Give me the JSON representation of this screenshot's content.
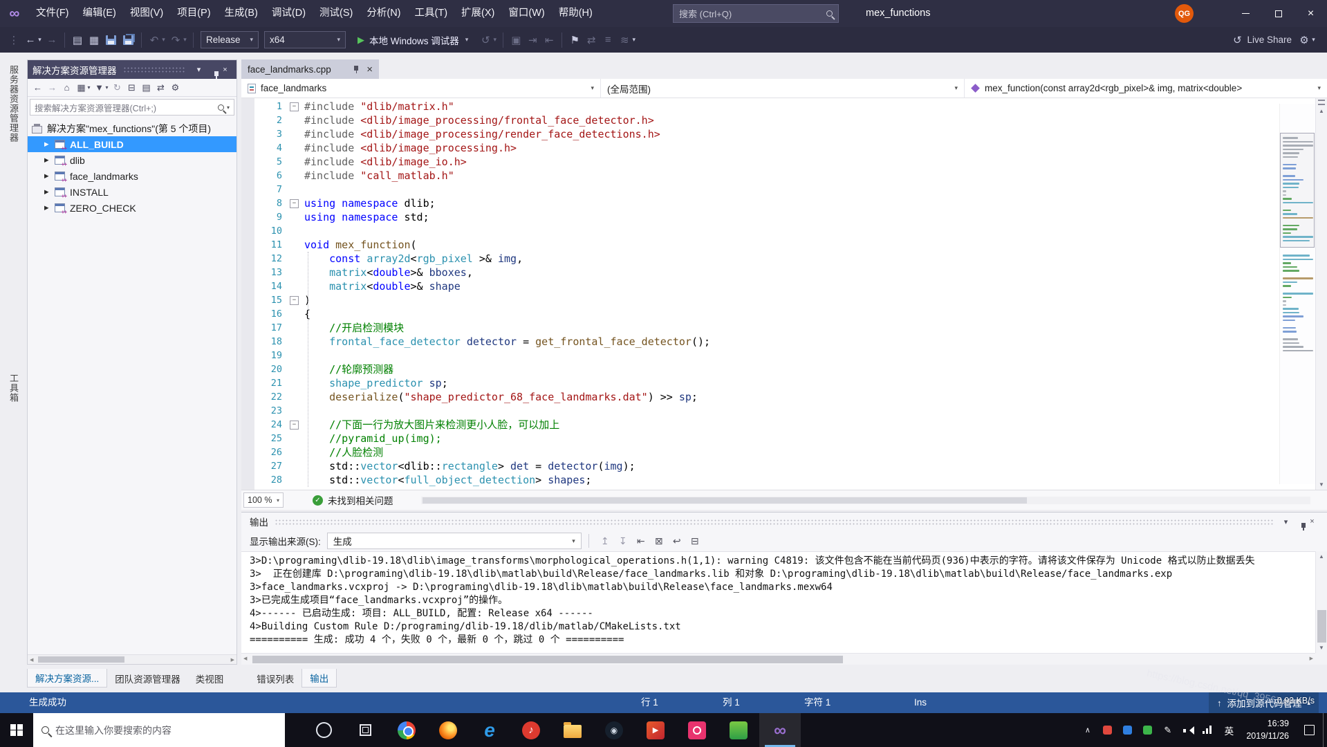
{
  "colors": {
    "selection": "#3399ff",
    "status_bar": "#2b579a",
    "title_bar": "#2f2f44",
    "taskbar": "#101018",
    "build_success_icon": "#3a9e3a",
    "tab_inactive": "#cccedb"
  },
  "icons": {
    "vs-logo": "∞",
    "close": "×",
    "dropdown": "▾",
    "tree-collapsed": "▶",
    "check": "✓",
    "up": "▲",
    "down": "▼",
    "left": "◀",
    "right": "▶",
    "play": "▶",
    "source-control-up": "↑",
    "caret-up": "▴"
  },
  "title_bar": {
    "menus": [
      "文件(F)",
      "编辑(E)",
      "视图(V)",
      "项目(P)",
      "生成(B)",
      "调试(D)",
      "测试(S)",
      "分析(N)",
      "工具(T)",
      "扩展(X)",
      "窗口(W)",
      "帮助(H)"
    ],
    "search_placeholder": "搜索 (Ctrl+Q)",
    "window_title": "mex_functions",
    "avatar_initials": "QG"
  },
  "toolbar": {
    "items": [
      {
        "t": "glyph",
        "name": "toolbar-grip-icon",
        "g": "⋮",
        "dim": 1
      },
      {
        "t": "glyph",
        "name": "nav-backward-icon",
        "g": "←"
      },
      {
        "t": "glyph",
        "name": "nav-backward-dropdown-icon",
        "g": "▾",
        "small": 1
      },
      {
        "t": "glyph",
        "name": "nav-forward-icon",
        "g": "→",
        "dim": 1
      },
      {
        "t": "sep"
      },
      {
        "t": "glyph",
        "name": "new-file-icon",
        "g": "▤"
      },
      {
        "t": "glyph",
        "name": "open-file-icon",
        "g": "▦"
      },
      {
        "t": "floppy",
        "name": "save-icon"
      },
      {
        "t": "floppy2",
        "name": "save-all-icon"
      },
      {
        "t": "sep"
      },
      {
        "t": "glyph",
        "name": "undo-icon",
        "g": "↶",
        "dim": 1
      },
      {
        "t": "glyph",
        "name": "undo-dropdown-icon",
        "g": "▾",
        "small": 1,
        "dim": 1
      },
      {
        "t": "glyph",
        "name": "redo-icon",
        "g": "↷",
        "dim": 1
      },
      {
        "t": "glyph",
        "name": "redo-dropdown-icon",
        "g": "▾",
        "small": 1,
        "dim": 1
      },
      {
        "t": "sep"
      },
      {
        "t": "combo",
        "name": "solution-configuration-dropdown",
        "label": "Release",
        "w": 84
      },
      {
        "t": "combo",
        "name": "solution-platform-dropdown",
        "label": "x64",
        "w": 118
      },
      {
        "t": "run",
        "name": "start-debugging-button",
        "label": "本地 Windows 调试器"
      },
      {
        "t": "glyph",
        "name": "debug-target-icon",
        "g": "↺",
        "dim": 1
      },
      {
        "t": "glyph",
        "name": "debug-target-dropdown-icon",
        "g": "▾",
        "small": 1,
        "dim": 1
      },
      {
        "t": "sep"
      },
      {
        "t": "glyph",
        "name": "build-icon",
        "g": "▣",
        "dim": 1
      },
      {
        "t": "glyph",
        "name": "step-over-icon",
        "g": "⇥",
        "dim": 1
      },
      {
        "t": "glyph",
        "name": "step-into-icon",
        "g": "⇤",
        "dim": 1
      },
      {
        "t": "sep"
      },
      {
        "t": "glyph",
        "name": "bookmark-icon",
        "g": "⚑"
      },
      {
        "t": "glyph",
        "name": "navigate-bookmark-icon",
        "g": "⇄",
        "dim": 1
      },
      {
        "t": "glyph",
        "name": "comment-icon",
        "g": "≡",
        "dim": 1
      },
      {
        "t": "glyph",
        "name": "uncomment-icon",
        "g": "≋",
        "dim": 1
      },
      {
        "t": "glyph",
        "name": "toolbar-overflow-icon",
        "g": "▾",
        "small": 1
      }
    ],
    "items_right": [
      {
        "t": "glyph",
        "name": "live-share-icon",
        "g": "↺"
      },
      {
        "t": "label",
        "name": "live-share-label",
        "label": "Live Share"
      },
      {
        "t": "glyph",
        "name": "feedback-icon",
        "g": "⚙"
      },
      {
        "t": "glyph",
        "name": "toolbar-options-dropdown-icon",
        "g": "▾",
        "small": 1
      }
    ]
  },
  "side_strip": [
    "服务器资源管理器",
    "工具箱"
  ],
  "solution_explorer": {
    "title": "解决方案资源管理器",
    "toolbar": [
      {
        "name": "se-back-icon",
        "g": "←"
      },
      {
        "name": "se-forward-icon",
        "g": "→",
        "dim": 1
      },
      {
        "name": "se-home-icon",
        "g": "⌂"
      },
      {
        "name": "se-switch-views-icon",
        "g": "▦"
      },
      {
        "name": "se-switch-views-dropdown-icon",
        "g": "▾",
        "small": 1
      },
      {
        "name": "se-filter-icon",
        "g": "▼"
      },
      {
        "name": "se-filter-dropdown-icon",
        "g": "▾",
        "small": 1
      },
      {
        "name": "se-refresh-icon",
        "g": "↻",
        "dim": 1
      },
      {
        "name": "se-collapse-all-icon",
        "g": "⊟"
      },
      {
        "name": "se-show-all-files-icon",
        "g": "▤"
      },
      {
        "name": "se-sync-active-document-icon",
        "g": "⇄"
      },
      {
        "name": "se-properties-icon",
        "g": "⚙"
      }
    ],
    "search_placeholder": "搜索解决方案资源管理器(Ctrl+;)",
    "root": "解决方案\"mex_functions\"(第 5 个项目)",
    "items": [
      {
        "label": "ALL_BUILD",
        "selected": true,
        "bold": true
      },
      {
        "label": "dlib"
      },
      {
        "label": "face_landmarks"
      },
      {
        "label": "INSTALL"
      },
      {
        "label": "ZERO_CHECK"
      }
    ]
  },
  "editor": {
    "tab": "face_landmarks.cpp",
    "nav_left": "face_landmarks",
    "nav_mid": "(全局范围)",
    "nav_right": "mex_function(const array2d<rgb_pixel>& img, matrix<double>",
    "zoom": "100 %",
    "health": "未找到相关问题",
    "minimap_colors": {
      "com": "#63a963",
      "str": "#cf8a80",
      "kw": "#7e9fd6",
      "typ": "#6fb3c9",
      "fn": "#b79b6b",
      "var": "#8b9bc9",
      "pre": "#a8adb5",
      "pl": "#b4b8be"
    },
    "code": [
      {
        "n": 1,
        "f": 1,
        "s": [
          [
            "pre",
            "#include "
          ],
          [
            "str",
            "\"dlib/matrix.h\""
          ]
        ]
      },
      {
        "n": 2,
        "s": [
          [
            "pre",
            "#include "
          ],
          [
            "str",
            "<dlib/image_processing/frontal_face_detector.h>"
          ]
        ]
      },
      {
        "n": 3,
        "s": [
          [
            "pre",
            "#include "
          ],
          [
            "str",
            "<dlib/image_processing/render_face_detections.h>"
          ]
        ]
      },
      {
        "n": 4,
        "s": [
          [
            "pre",
            "#include "
          ],
          [
            "str",
            "<dlib/image_processing.h>"
          ]
        ]
      },
      {
        "n": 5,
        "s": [
          [
            "pre",
            "#include "
          ],
          [
            "str",
            "<dlib/image_io.h>"
          ]
        ]
      },
      {
        "n": 6,
        "s": [
          [
            "pre",
            "#include "
          ],
          [
            "str",
            "\"call_matlab.h\""
          ]
        ]
      },
      {
        "n": 7,
        "s": []
      },
      {
        "n": 8,
        "f": 1,
        "s": [
          [
            "kw",
            "using namespace"
          ],
          [
            "pl",
            " dlib;"
          ]
        ]
      },
      {
        "n": 9,
        "s": [
          [
            "kw",
            "using namespace"
          ],
          [
            "pl",
            " std;"
          ]
        ]
      },
      {
        "n": 10,
        "s": []
      },
      {
        "n": 11,
        "s": [
          [
            "kw",
            "void"
          ],
          [
            "pl",
            " "
          ],
          [
            "fn",
            "mex_function"
          ],
          [
            "pl",
            "("
          ]
        ]
      },
      {
        "n": 12,
        "s": [
          [
            "pl",
            "    "
          ],
          [
            "kw",
            "const"
          ],
          [
            "pl",
            " "
          ],
          [
            "typ",
            "array2d"
          ],
          [
            "pl",
            "<"
          ],
          [
            "typ",
            "rgb_pixel"
          ],
          [
            "pl",
            " >& "
          ],
          [
            "var",
            "img"
          ],
          [
            "pl",
            ","
          ]
        ]
      },
      {
        "n": 13,
        "s": [
          [
            "pl",
            "    "
          ],
          [
            "typ",
            "matrix"
          ],
          [
            "pl",
            "<"
          ],
          [
            "kw",
            "double"
          ],
          [
            "pl",
            ">& "
          ],
          [
            "var",
            "bboxes"
          ],
          [
            "pl",
            ","
          ]
        ]
      },
      {
        "n": 14,
        "s": [
          [
            "pl",
            "    "
          ],
          [
            "typ",
            "matrix"
          ],
          [
            "pl",
            "<"
          ],
          [
            "kw",
            "double"
          ],
          [
            "pl",
            ">& "
          ],
          [
            "var",
            "shape"
          ]
        ]
      },
      {
        "n": 15,
        "f": 1,
        "s": [
          [
            "pl",
            ")"
          ]
        ]
      },
      {
        "n": 16,
        "s": [
          [
            "pl",
            "{"
          ]
        ]
      },
      {
        "n": 17,
        "s": [
          [
            "pl",
            "    "
          ],
          [
            "com",
            "//开启检测模块"
          ]
        ]
      },
      {
        "n": 18,
        "s": [
          [
            "pl",
            "    "
          ],
          [
            "typ",
            "frontal_face_detector"
          ],
          [
            "pl",
            " "
          ],
          [
            "var",
            "detector"
          ],
          [
            "pl",
            " = "
          ],
          [
            "fn",
            "get_frontal_face_detector"
          ],
          [
            "pl",
            "();"
          ]
        ]
      },
      {
        "n": 19,
        "s": []
      },
      {
        "n": 20,
        "s": [
          [
            "pl",
            "    "
          ],
          [
            "com",
            "//轮廓预测器"
          ]
        ]
      },
      {
        "n": 21,
        "s": [
          [
            "pl",
            "    "
          ],
          [
            "typ",
            "shape_predictor"
          ],
          [
            "pl",
            " "
          ],
          [
            "var",
            "sp"
          ],
          [
            "pl",
            ";"
          ]
        ]
      },
      {
        "n": 22,
        "s": [
          [
            "pl",
            "    "
          ],
          [
            "fn",
            "deserialize"
          ],
          [
            "pl",
            "("
          ],
          [
            "str",
            "\"shape_predictor_68_face_landmarks.dat\""
          ],
          [
            "pl",
            ") >> "
          ],
          [
            "var",
            "sp"
          ],
          [
            "pl",
            ";"
          ]
        ]
      },
      {
        "n": 23,
        "s": []
      },
      {
        "n": 24,
        "f": 1,
        "s": [
          [
            "pl",
            "    "
          ],
          [
            "com",
            "//下面一行为放大图片来检测更小人脸，可以加上"
          ]
        ]
      },
      {
        "n": 25,
        "s": [
          [
            "pl",
            "    "
          ],
          [
            "com",
            "//pyramid_up(img);"
          ]
        ]
      },
      {
        "n": 26,
        "s": [
          [
            "pl",
            "    "
          ],
          [
            "com",
            "//人脸检测"
          ]
        ]
      },
      {
        "n": 27,
        "s": [
          [
            "pl",
            "    std::"
          ],
          [
            "typ",
            "vector"
          ],
          [
            "pl",
            "<dlib::"
          ],
          [
            "typ",
            "rectangle"
          ],
          [
            "pl",
            "> "
          ],
          [
            "var",
            "det"
          ],
          [
            "pl",
            " = "
          ],
          [
            "var",
            "detector"
          ],
          [
            "pl",
            "("
          ],
          [
            "var",
            "img"
          ],
          [
            "pl",
            ");"
          ]
        ]
      },
      {
        "n": 28,
        "s": [
          [
            "pl",
            "    std::"
          ],
          [
            "typ",
            "vector"
          ],
          [
            "pl",
            "<"
          ],
          [
            "typ",
            "full_object_detection"
          ],
          [
            "pl",
            "> "
          ],
          [
            "var",
            "shapes"
          ],
          [
            "pl",
            ";"
          ]
        ]
      }
    ]
  },
  "output": {
    "title": "输出",
    "source_label": "显示输出来源(S):",
    "source_value": "生成",
    "toolbar": [
      {
        "name": "out-prev-message-icon",
        "g": "↥",
        "dim": 1
      },
      {
        "name": "out-next-message-icon",
        "g": "↧",
        "dim": 1
      },
      {
        "name": "out-go-to-icon",
        "g": "⇤"
      },
      {
        "name": "out-clear-all-icon",
        "g": "⊠"
      },
      {
        "name": "out-word-wrap-icon",
        "g": "↩"
      },
      {
        "name": "out-autoscroll-icon",
        "g": "⊟"
      }
    ],
    "lines": [
      "3>D:\\programing\\dlib-19.18\\dlib\\image_transforms\\morphological_operations.h(1,1): warning C4819: 该文件包含不能在当前代码页(936)中表示的字符。请将该文件保存为 Unicode 格式以防止数据丢失",
      "3>  正在创建库 D:\\programing\\dlib-19.18\\dlib\\matlab\\build\\Release/face_landmarks.lib 和对象 D:\\programing\\dlib-19.18\\dlib\\matlab\\build\\Release/face_landmarks.exp",
      "3>face_landmarks.vcxproj -> D:\\programing\\dlib-19.18\\dlib\\matlab\\build\\Release\\face_landmarks.mexw64",
      "3>已完成生成项目“face_landmarks.vcxproj”的操作。",
      "4>------ 已启动生成: 项目: ALL_BUILD, 配置: Release x64 ------",
      "4>Building Custom Rule D:/programing/dlib-19.18/dlib/matlab/CMakeLists.txt",
      "========== 生成: 成功 4 个，失败 0 个，最新 0 个，跳过 0 个 =========="
    ]
  },
  "bottom_tabs": [
    {
      "label": "解决方案资源...",
      "name": "tab-solution-explorer",
      "active": true
    },
    {
      "label": "团队资源管理器",
      "name": "tab-team-explorer"
    },
    {
      "label": "类视图",
      "name": "tab-class-view"
    },
    {
      "label": "错误列表",
      "name": "tab-error-list",
      "gap": true
    },
    {
      "label": "输出",
      "name": "tab-output",
      "active": true
    }
  ],
  "status_bar": {
    "left": "生成成功",
    "line": "行 1",
    "col": "列 1",
    "char": "字符 1",
    "ins": "Ins",
    "source_control": "添加到源代码管理"
  },
  "taskbar": {
    "search_placeholder": "在这里输入你要搜索的内容",
    "apps": [
      {
        "name": "cortana-icon",
        "kind": "cortana"
      },
      {
        "name": "task-view-icon",
        "kind": "taskview"
      },
      {
        "name": "chrome-icon",
        "kind": "chrome"
      },
      {
        "name": "firefox-icon",
        "kind": "firefox"
      },
      {
        "name": "edge-icon",
        "kind": "edge",
        "glyph": "e"
      },
      {
        "name": "music-app-icon",
        "kind": "music",
        "glyph": "♪"
      },
      {
        "name": "file-explorer-icon",
        "kind": "explorer"
      },
      {
        "name": "steam-icon",
        "kind": "steam",
        "glyph": "◉"
      },
      {
        "name": "media-player-icon",
        "kind": "media",
        "glyph": "▶"
      },
      {
        "name": "design-app-icon",
        "kind": "pink"
      },
      {
        "name": "photos-app-icon",
        "kind": "green"
      },
      {
        "name": "visual-studio-icon",
        "kind": "vs",
        "glyph": "∞",
        "active": true
      }
    ],
    "tray": [
      {
        "name": "tray-expand-icon",
        "kind": "chev",
        "glyph": "∧"
      },
      {
        "name": "tray-music-icon",
        "kind": "dot",
        "color": "#e0483e"
      },
      {
        "name": "tray-app-blue-icon",
        "kind": "dot",
        "color": "#2f7fe0"
      },
      {
        "name": "tray-wechat-icon",
        "kind": "dot",
        "color": "#3cb54a"
      },
      {
        "name": "tray-pen-icon",
        "kind": "pen",
        "glyph": "✎"
      },
      {
        "name": "volume-icon",
        "kind": "vol"
      },
      {
        "name": "network-icon",
        "kind": "net"
      }
    ],
    "ime": "英",
    "time": "16:39",
    "date": "2019/11/26"
  },
  "overlay": {
    "watermark": "https://blog.csdn.net/qq_39567427",
    "speed": "0.93 KB/s"
  }
}
